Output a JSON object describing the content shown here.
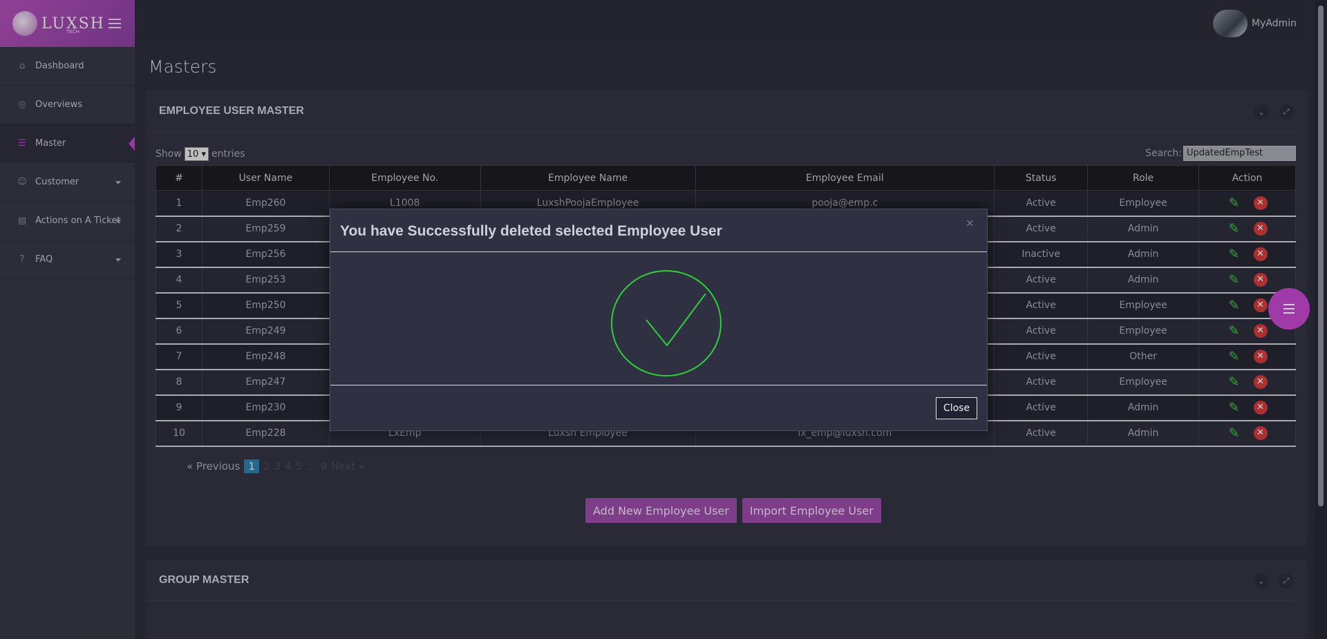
{
  "brand": {
    "name": "LUXSH",
    "sub": "TECH"
  },
  "topbar": {
    "user_name": "MyAdmin"
  },
  "sidebar": {
    "items": [
      {
        "label": "Dashboard"
      },
      {
        "label": "Overviews"
      },
      {
        "label": "Master"
      },
      {
        "label": "Customer"
      },
      {
        "label": "Actions on A Ticket"
      },
      {
        "label": "FAQ"
      }
    ]
  },
  "page": {
    "title": "Masters"
  },
  "panel1": {
    "title": "EMPLOYEE USER MASTER",
    "show_label": "Show",
    "entries_value": "10",
    "entries_label": "entries",
    "search_label": "Search:",
    "search_value": "UpdatedEmpTest",
    "columns": [
      "#",
      "User Name",
      "Employee No.",
      "Employee Name",
      "Employee Email",
      "Status",
      "Role",
      "Action"
    ],
    "rows": [
      [
        "1",
        "Emp260",
        "L1008",
        "LuxshPoojaEmployee",
        "pooja@emp.c",
        "Active",
        "Employee"
      ],
      [
        "2",
        "Emp259",
        "",
        "",
        "",
        "Active",
        "Admin"
      ],
      [
        "3",
        "Emp256",
        "",
        "",
        "",
        "Inactive",
        "Admin"
      ],
      [
        "4",
        "Emp253",
        "",
        "",
        "",
        "Active",
        "Admin"
      ],
      [
        "5",
        "Emp250",
        "",
        "",
        "",
        "Active",
        "Employee"
      ],
      [
        "6",
        "Emp249",
        "",
        "",
        "",
        "Active",
        "Employee"
      ],
      [
        "7",
        "Emp248",
        "",
        "",
        "",
        "Active",
        "Other"
      ],
      [
        "8",
        "Emp247",
        "",
        "",
        "",
        "Active",
        "Employee"
      ],
      [
        "9",
        "Emp230",
        "",
        "",
        "",
        "Active",
        "Admin"
      ],
      [
        "10",
        "Emp228",
        "LxEmp",
        "Luxsh Employee",
        "lx_emp@luxsh.com",
        "Active",
        "Admin"
      ]
    ],
    "pager": {
      "prev": "Previous",
      "next": "Next",
      "pages": [
        "1",
        "2",
        "3",
        "4",
        "5",
        "...",
        "9"
      ]
    },
    "add_button": "Add New Employee User",
    "import_button": "Import Employee User"
  },
  "panel2": {
    "title": "GROUP MASTER"
  },
  "modal": {
    "title": "You have Successfully deleted selected Employee User",
    "close_label": "Close"
  },
  "colors": {
    "accent": "#b548c6",
    "success": "#2fcf3a",
    "danger": "#d33b3b"
  }
}
